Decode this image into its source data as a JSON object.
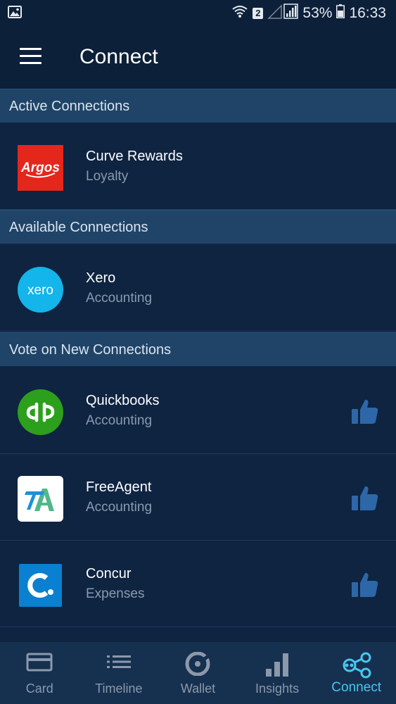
{
  "status_bar": {
    "sim_badge": "2",
    "battery": "53%",
    "time": "16:33",
    "icons": [
      "image-notification-icon",
      "wifi-icon",
      "signal-icon",
      "battery-icon"
    ]
  },
  "header": {
    "title": "Connect",
    "menu_icon": "hamburger-menu-icon"
  },
  "sections": {
    "active": {
      "title": "Active Connections",
      "items": [
        {
          "title": "Curve Rewards",
          "subtitle": "Loyalty",
          "logo": "argos-logo",
          "logo_text": "Argos"
        }
      ]
    },
    "available": {
      "title": "Available Connections",
      "items": [
        {
          "title": "Xero",
          "subtitle": "Accounting",
          "logo": "xero-logo",
          "logo_text": "xero"
        }
      ]
    },
    "vote": {
      "title": "Vote on New Connections",
      "items": [
        {
          "title": "Quickbooks",
          "subtitle": "Accounting",
          "logo": "quickbooks-logo",
          "action_icon": "thumbs-up-icon"
        },
        {
          "title": "FreeAgent",
          "subtitle": "Accounting",
          "logo": "freeagent-logo",
          "action_icon": "thumbs-up-icon"
        },
        {
          "title": "Concur",
          "subtitle": "Expenses",
          "logo": "concur-logo",
          "action_icon": "thumbs-up-icon"
        }
      ]
    }
  },
  "bottom_nav": {
    "items": [
      {
        "label": "Card",
        "icon": "card-icon"
      },
      {
        "label": "Timeline",
        "icon": "timeline-icon"
      },
      {
        "label": "Wallet",
        "icon": "wallet-icon"
      },
      {
        "label": "Insights",
        "icon": "insights-icon"
      },
      {
        "label": "Connect",
        "icon": "connect-share-icon",
        "active": true
      }
    ]
  },
  "colors": {
    "background": "#0e2441",
    "appbar": "#0c2039",
    "section_header": "#1f4468",
    "accent": "#49c6ef",
    "argos_red": "#e4271b",
    "xero_blue": "#13b5ea",
    "quickbooks_green": "#2ca01c",
    "concur_blue": "#0a80d0",
    "thumb": "#2d67a8",
    "subtitle": "#8a9bb0"
  }
}
